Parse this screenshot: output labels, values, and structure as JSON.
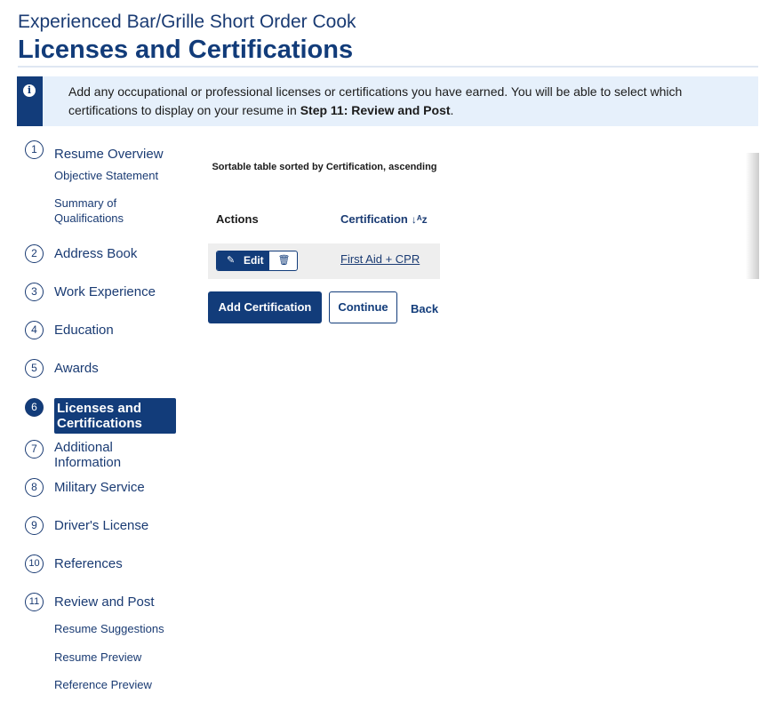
{
  "header": {
    "job_title": "Experienced Bar/Grille Short Order Cook",
    "page_title": "Licenses and Certifications"
  },
  "alert": {
    "icon": "info-icon",
    "text_before": "Add any occupational or professional licenses or certifications you have earned. You will be able to select which certifications to display on your resume in ",
    "text_bold": "Step 11: Review and Post",
    "text_after": "."
  },
  "sidebar": {
    "steps": [
      {
        "num": "1",
        "label": "Resume Overview",
        "subs": [
          "Objective Statement",
          "Summary of Qualifications"
        ]
      },
      {
        "num": "2",
        "label": "Address Book"
      },
      {
        "num": "3",
        "label": "Work Experience"
      },
      {
        "num": "4",
        "label": "Education"
      },
      {
        "num": "5",
        "label": "Awards"
      },
      {
        "num": "6",
        "label": "Licenses and Certifications",
        "active": true
      },
      {
        "num": "7",
        "label": "Additional Information"
      },
      {
        "num": "8",
        "label": "Military Service"
      },
      {
        "num": "9",
        "label": "Driver's License"
      },
      {
        "num": "10",
        "label": "References"
      },
      {
        "num": "11",
        "label": "Review and Post",
        "subs": [
          "Resume Suggestions",
          "Resume Preview",
          "Reference Preview"
        ]
      }
    ]
  },
  "table": {
    "caption": "Sortable table sorted by Certification, ascending",
    "columns": [
      "Actions",
      "Certification"
    ],
    "sort_icon": "sort-ascending-icon",
    "rows": [
      {
        "edit_label": "Edit",
        "certification": "First Aid + CPR"
      }
    ]
  },
  "actions": {
    "add_label": "Add Certification",
    "continue_label": "Continue",
    "back_label": "Back"
  },
  "colors": {
    "primary": "#123c7a",
    "alert_bg": "#e6f0fb",
    "row_bg": "#eeeeee"
  }
}
